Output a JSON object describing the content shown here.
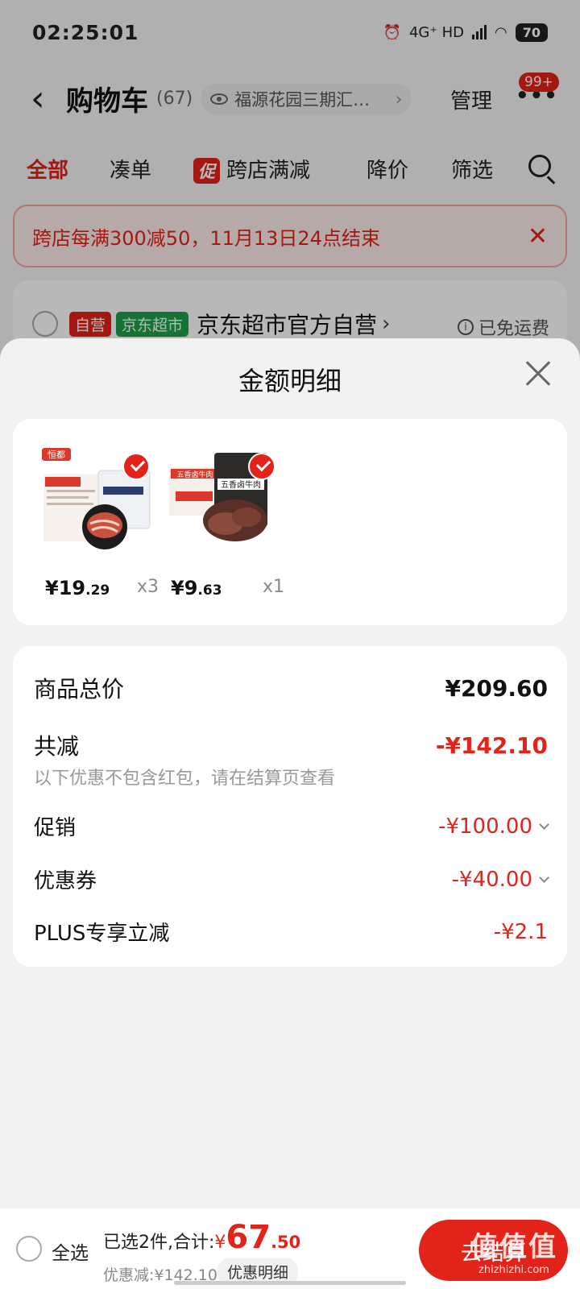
{
  "status_bar": {
    "time": "02:25:01",
    "network": "4G⁺ HD",
    "battery": "70"
  },
  "header": {
    "back_icon": "chevron-left-icon",
    "title": "购物车",
    "count": "(67)",
    "address": "福源花园三期汇…",
    "manage": "管理",
    "more_badge": "99+"
  },
  "tabs": [
    {
      "label": "全部",
      "active": true
    },
    {
      "label": "凑单"
    },
    {
      "label": "跨店满减",
      "tag": "促"
    },
    {
      "label": "降价"
    },
    {
      "label": "筛选"
    }
  ],
  "notice": {
    "text": "跨店每满300减50，11月13日24点结束"
  },
  "store": {
    "tag_self": "自营",
    "tag_market": "京东超市",
    "name": "京东超市官方自营",
    "shipping": "已免运费"
  },
  "sheet": {
    "title": "金额明细",
    "products": [
      {
        "brand": "恒都",
        "price_int": "¥19",
        "price_dec": ".29",
        "qty": "x3",
        "image": "beef-slices-package"
      },
      {
        "brand": "五香卤牛肉",
        "price_int": "¥9",
        "price_dec": ".63",
        "qty": "x1",
        "image": "spiced-beef-package"
      }
    ],
    "details": {
      "total_label": "商品总价",
      "total_value": "¥209.60",
      "reduce_label": "共减",
      "reduce_value": "-¥142.10",
      "note": "以下优惠不包含红包，请在结算页查看",
      "promo_label": "促销",
      "promo_value": "-¥100.00",
      "coupon_label": "优惠券",
      "coupon_value": "-¥40.00",
      "plus_label": "PLUS专享立减",
      "plus_value": "-¥2.1"
    }
  },
  "checkout": {
    "select_all": "全选",
    "summary_prefix": "已选2件,合计:",
    "currency": "¥",
    "amount_int": "67",
    "amount_dec": ".50",
    "discount": "优惠减:¥142.10",
    "detail_button": "优惠明细",
    "checkout_button": "去结算"
  },
  "watermark": {
    "text": "值值值",
    "site": "zhizhizhi.com"
  },
  "colors": {
    "accent": "#e2231a",
    "green_tag": "#1ca04a"
  }
}
